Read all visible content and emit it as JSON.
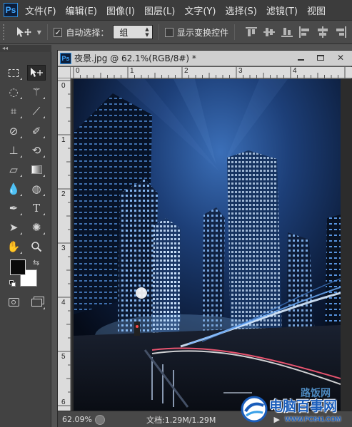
{
  "app": {
    "logo": "Ps"
  },
  "menu": [
    "文件(F)",
    "编辑(E)",
    "图像(I)",
    "图层(L)",
    "文字(Y)",
    "选择(S)",
    "滤镜(T)",
    "视图"
  ],
  "options": {
    "tool_icon": "move-tool-icon",
    "auto_select_checked": true,
    "auto_select_label": "自动选择：",
    "auto_select_target": "组",
    "show_transform_checked": false,
    "show_transform_label": "显示变换控件"
  },
  "toolbox": {
    "collapse": "◂◂",
    "tools": [
      {
        "name": "marquee-tool",
        "icon": "marquee-icon",
        "glyph": "⬚"
      },
      {
        "name": "move-tool",
        "icon": "move-icon",
        "glyph": "✥",
        "active": true
      },
      {
        "name": "lasso-tool",
        "icon": "lasso-icon",
        "glyph": "◌"
      },
      {
        "name": "magic-wand-tool",
        "icon": "magic-wand-icon",
        "glyph": "✲"
      },
      {
        "name": "crop-tool",
        "icon": "crop-icon",
        "glyph": "⌗"
      },
      {
        "name": "eyedropper-tool",
        "icon": "eyedropper-icon",
        "glyph": "⁄"
      },
      {
        "name": "healing-brush-tool",
        "icon": "bandage-icon",
        "glyph": "⊘"
      },
      {
        "name": "brush-tool",
        "icon": "brush-icon",
        "glyph": "⟋"
      },
      {
        "name": "clone-stamp-tool",
        "icon": "stamp-icon",
        "glyph": "⊥"
      },
      {
        "name": "history-brush-tool",
        "icon": "history-brush-icon",
        "glyph": "⟲"
      },
      {
        "name": "eraser-tool",
        "icon": "eraser-icon",
        "glyph": "▱"
      },
      {
        "name": "gradient-tool",
        "icon": "gradient-icon",
        "glyph": "▤"
      },
      {
        "name": "blur-tool",
        "icon": "blur-drop-icon",
        "glyph": "●"
      },
      {
        "name": "dodge-tool",
        "icon": "dodge-icon",
        "glyph": "◍"
      },
      {
        "name": "pen-tool",
        "icon": "pen-icon",
        "glyph": "✎"
      },
      {
        "name": "type-tool",
        "icon": "type-icon",
        "glyph": "T"
      },
      {
        "name": "path-selection-tool",
        "icon": "path-select-icon",
        "glyph": "➤"
      },
      {
        "name": "custom-shape-tool",
        "icon": "shape-icon",
        "glyph": "✺"
      },
      {
        "name": "hand-tool",
        "icon": "hand-icon",
        "glyph": "✋"
      },
      {
        "name": "zoom-tool",
        "icon": "zoom-icon",
        "glyph": "⚲"
      }
    ],
    "foreground_color": "#0a0a0a",
    "background_color": "#ffffff"
  },
  "document": {
    "title": "夜景.jpg @ 62.1%(RGB/8#) *",
    "ruler_h": [
      "0",
      "1",
      "2",
      "3",
      "4"
    ],
    "ruler_v": [
      "0",
      "1",
      "2",
      "3",
      "4",
      "5",
      "6"
    ],
    "zoom": "62.09%",
    "doc_info": "文档:1.29M/1.29M",
    "more_arrow": "▶"
  },
  "watermark": {
    "brand": "电脑百事网",
    "site": "WWW.PC841.COM",
    "top": "路饭网"
  },
  "colors": {
    "menubar": "#3c3c3c",
    "panel": "#535353",
    "accent": "#2f8fe0"
  }
}
